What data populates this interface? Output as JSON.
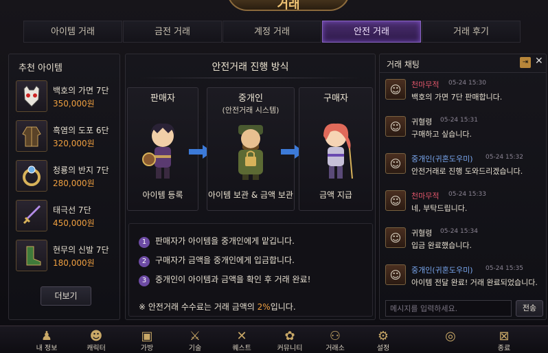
{
  "title": "거래",
  "tabs": [
    {
      "label": "아이템 거래"
    },
    {
      "label": "금전 거래"
    },
    {
      "label": "계정 거래"
    },
    {
      "label": "안전 거래"
    },
    {
      "label": "거래 후기"
    }
  ],
  "recommended": {
    "title": "추천 아이템",
    "items": [
      {
        "name": "백호의 가면 7단",
        "price": "350,000원"
      },
      {
        "name": "흑염의 도포 6단",
        "price": "320,000원"
      },
      {
        "name": "청룡의 반지 7단",
        "price": "280,000원"
      },
      {
        "name": "태극선 7단",
        "price": "450,000원"
      },
      {
        "name": "현무의 신발 7단",
        "price": "180,000원"
      }
    ],
    "more_label": "더보기"
  },
  "process": {
    "title": "안전거래 진행 방식",
    "roles": [
      {
        "title": "판매자",
        "subtitle": "",
        "caption": "아이템 등록"
      },
      {
        "title": "중개인",
        "subtitle": "(안전거래 시스템)",
        "caption": "아이템 보관 & 금액 보관"
      },
      {
        "title": "구매자",
        "subtitle": "",
        "caption": "금액 지급"
      }
    ],
    "steps": [
      {
        "num": "1",
        "text": "판매자가 아이템을 중개인에게 맡깁니다."
      },
      {
        "num": "2",
        "text": "구매자가 금액을 중개인에게 입금합니다."
      },
      {
        "num": "3",
        "text": "중개인이 아이템과 금액을 확인 후 거래 완료!"
      }
    ],
    "note_prefix": "※ 안전거래 수수료는 거래 금액의 ",
    "note_pct": "2%",
    "note_suffix": "입니다."
  },
  "chat": {
    "title": "거래 채팅",
    "messages": [
      {
        "name": "천마무적",
        "time": "05-24 15:30",
        "text": "백호의 가면 7단 판매합니다.",
        "color": "#e0566a"
      },
      {
        "name": "귀혈령",
        "time": "05-24 15:31",
        "text": "구매하고 싶습니다.",
        "color": "#e6dfd0"
      },
      {
        "name": "중개인(귀혼도우미)",
        "time": "05-24 15:32",
        "text": "안전거래로 진행 도와드리겠습니다.",
        "color": "#7aa8f0"
      },
      {
        "name": "천마무적",
        "time": "05-24 15:33",
        "text": "네, 부탁드립니다.",
        "color": "#e0566a"
      },
      {
        "name": "귀혈령",
        "time": "05-24 15:34",
        "text": "입금 완료했습니다.",
        "color": "#e6dfd0"
      },
      {
        "name": "중개인(귀혼도우미)",
        "time": "05-24 15:35",
        "text": "아이템 전달 완료! 거래 완료되었습니다.",
        "color": "#7aa8f0"
      }
    ],
    "input_placeholder": "메시지를 입력하세요.",
    "send_label": "전송"
  },
  "bottom_nav": [
    {
      "label": "내 정보",
      "icon": "user-icon"
    },
    {
      "label": "캐릭터",
      "icon": "character-icon"
    },
    {
      "label": "가방",
      "icon": "bag-icon"
    },
    {
      "label": "기술",
      "icon": "skill-icon"
    },
    {
      "label": "퀘스트",
      "icon": "quest-icon"
    },
    {
      "label": "커뮤니티",
      "icon": "community-icon"
    },
    {
      "label": "거래소",
      "icon": "trade-icon"
    },
    {
      "label": "설정",
      "icon": "gear-icon"
    },
    {
      "label": "",
      "icon": "shield-icon"
    },
    {
      "label": "종료",
      "icon": "exit-icon"
    }
  ],
  "colors": {
    "accent": "#6d4ba4",
    "price": "#f0a040",
    "arrow": "#3c7ad8"
  }
}
